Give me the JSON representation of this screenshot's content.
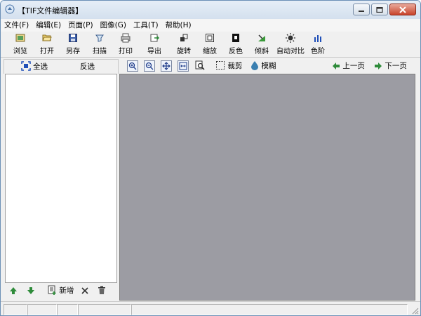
{
  "window": {
    "title": "【TIF文件编辑器】"
  },
  "menu": [
    "文件(F)",
    "编辑(E)",
    "页面(P)",
    "图像(G)",
    "工具(T)",
    "帮助(H)"
  ],
  "toolbar": {
    "browse": "浏览",
    "open": "打开",
    "save_as": "另存",
    "scan": "扫描",
    "print": "打印",
    "export": "导出",
    "rotate": "旋转",
    "zoom": "缩放",
    "invert": "反色",
    "skew": "倾斜",
    "auto_contrast": "自动对比",
    "levels": "色阶"
  },
  "left_panel": {
    "select_all": "全选",
    "invert_selection": "反选",
    "add_new": "新增"
  },
  "viewer": {
    "crop": "裁剪",
    "blur": "模糊",
    "prev_page": "上一页",
    "next_page": "下一页"
  },
  "colors": {
    "canvas": "#9c9ca3",
    "accent_green": "#2e8b3a",
    "accent_blue": "#1f4fb8"
  }
}
